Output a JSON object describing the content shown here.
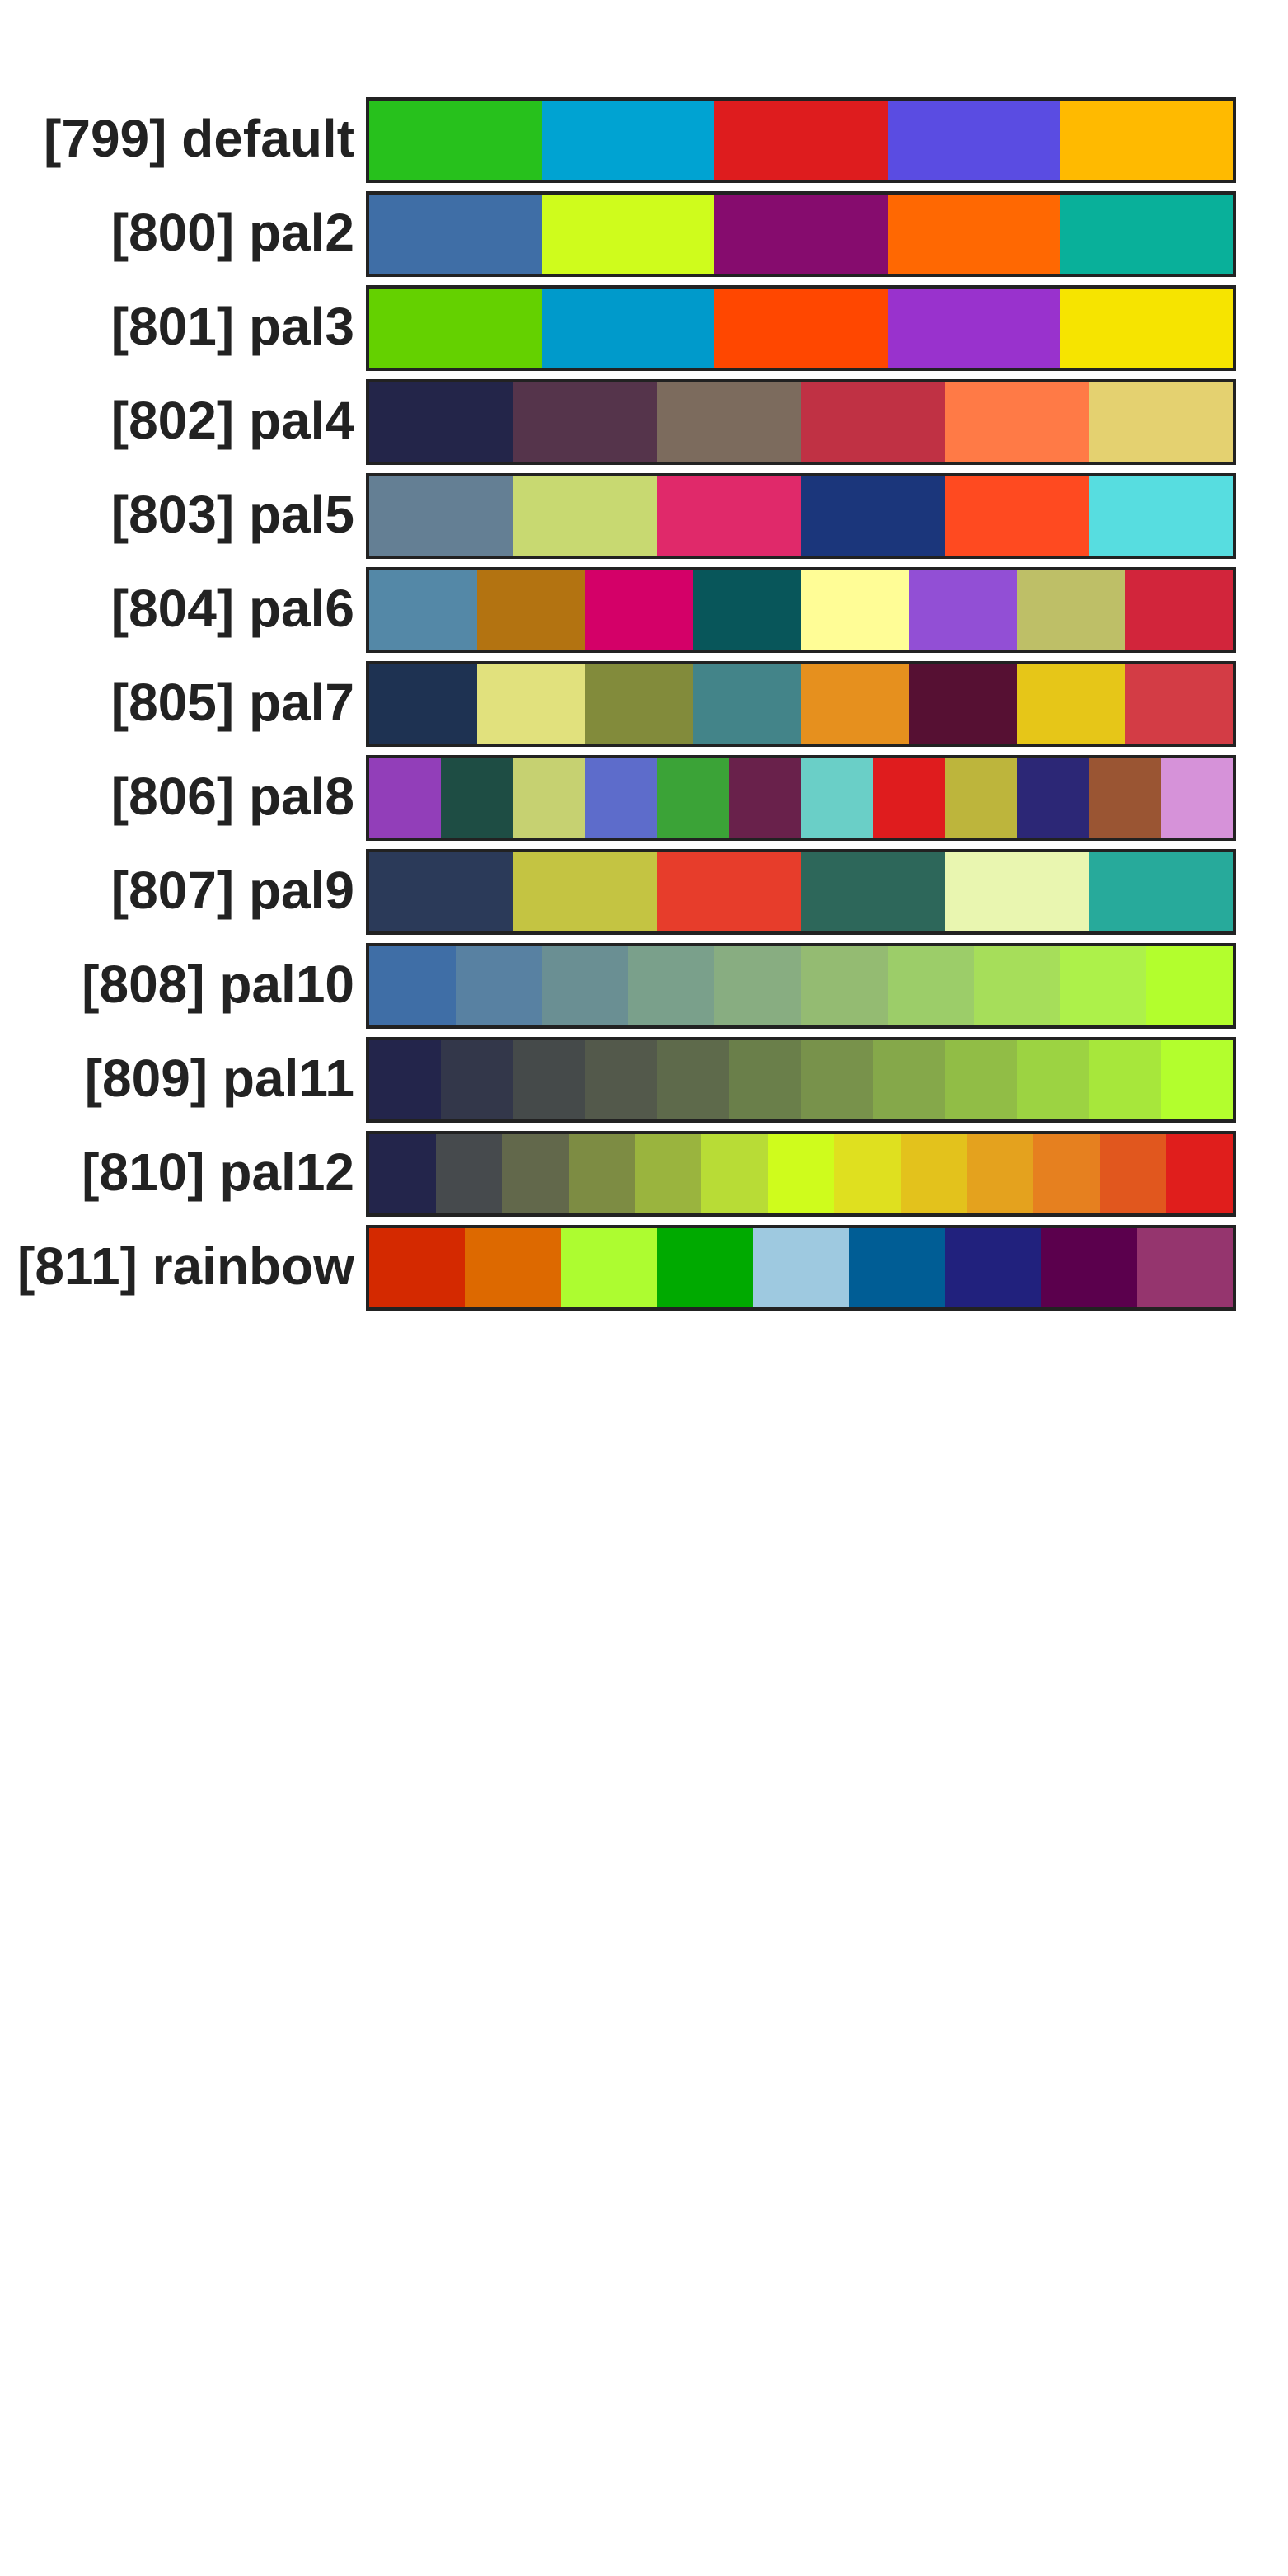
{
  "palettes": [
    {
      "label": "[799] default",
      "colors": [
        "#27c11c",
        "#00a3d2",
        "#de1c1e",
        "#5a4ce2",
        "#ffba00"
      ]
    },
    {
      "label": "[800] pal2",
      "colors": [
        "#3f6ea6",
        "#cffc1c",
        "#860c6e",
        "#ff6802",
        "#09b09a"
      ]
    },
    {
      "label": "[801] pal3",
      "colors": [
        "#64d100",
        "#009acb",
        "#ff4700",
        "#9932cd",
        "#f6e400"
      ]
    },
    {
      "label": "[802] pal4",
      "colors": [
        "#232549",
        "#55344b",
        "#7c6b5d",
        "#c03144",
        "#ff7a46",
        "#e4d170"
      ]
    },
    {
      "label": "[803] pal5",
      "colors": [
        "#647f94",
        "#c8d971",
        "#e0296a",
        "#1b367b",
        "#ff4a20",
        "#57dde0"
      ]
    },
    {
      "label": "[804] pal6",
      "colors": [
        "#5488a7",
        "#b37311",
        "#d40068",
        "#08565a",
        "#fffd96",
        "#924fd5",
        "#bebf67",
        "#d2253b"
      ]
    },
    {
      "label": "[805] pal7",
      "colors": [
        "#1e3252",
        "#e1e17d",
        "#828b3b",
        "#438489",
        "#e6901e",
        "#561033",
        "#e6c618",
        "#d33c45"
      ]
    },
    {
      "label": "[806] pal8",
      "colors": [
        "#923eb9",
        "#1e4d44",
        "#c6d171",
        "#5d6ccb",
        "#3ba337",
        "#69214b",
        "#6acfc7",
        "#df1c1e",
        "#bdb53c",
        "#2c2776",
        "#9a5533",
        "#d692d9"
      ]
    },
    {
      "label": "[807] pal9",
      "colors": [
        "#2b3a59",
        "#c4c442",
        "#e73d2b",
        "#2d675a",
        "#e9f6b0",
        "#27aa9b"
      ]
    },
    {
      "label": "[808] pal10",
      "colors": [
        "#3f6ea6",
        "#5881a2",
        "#6a8f93",
        "#7aa08b",
        "#88ad81",
        "#94bb72",
        "#9ccd69",
        "#a6de5a",
        "#adf14a",
        "#b3fe2d"
      ]
    },
    {
      "label": "[809] pal11",
      "colors": [
        "#23254b",
        "#33374a",
        "#454a4a",
        "#53594b",
        "#5e6a4b",
        "#6a7f4a",
        "#78924b",
        "#85a84a",
        "#91bd46",
        "#9cd342",
        "#a7e73b",
        "#b3fe2d"
      ]
    },
    {
      "label": "[810] pal12",
      "colors": [
        "#23254b",
        "#464a4d",
        "#62684b",
        "#7d8c43",
        "#9ab43e",
        "#b8dc36",
        "#cffc1c",
        "#dfe01f",
        "#e3c21c",
        "#e4a21e",
        "#e6801f",
        "#e1571e",
        "#e01e1c"
      ]
    },
    {
      "label": "[811] rainbow",
      "colors": [
        "#d42900",
        "#dd6900",
        "#adfc30",
        "#00aa00",
        "#9ec9e0",
        "#005d95",
        "#21217d",
        "#5b004d",
        "#95356e"
      ]
    }
  ]
}
